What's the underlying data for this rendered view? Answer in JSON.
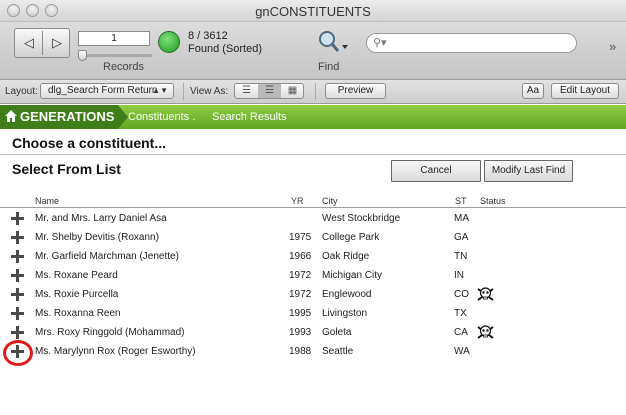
{
  "window": {
    "title": "gnCONSTITUENTS"
  },
  "toolbar": {
    "record_input_value": "1",
    "records_label": "Records",
    "record_count": "8 / 3612",
    "found_status": "Found (Sorted)",
    "find_label": "Find",
    "search_placeholder": "",
    "overflow_glyph": "»"
  },
  "layout_bar": {
    "layout_label": "Layout:",
    "layout_value": "dlg_Search Form Return",
    "view_as_label": "View As:",
    "preview_label": "Preview",
    "text_format_label": "Aa",
    "edit_layout_label": "Edit Layout"
  },
  "banner": {
    "app_name": "GENERATIONS",
    "breadcrumb_1": "Constituents .",
    "breadcrumb_2": "Search Results",
    "color": "#5ea821"
  },
  "dialog": {
    "heading": "Choose a constituent...",
    "subheading": "Select From List",
    "cancel_label": "Cancel",
    "modify_label": "Modify Last Find"
  },
  "table": {
    "columns": {
      "name": "Name",
      "yr": "YR",
      "city": "City",
      "st": "ST",
      "status": "Status"
    },
    "rows": [
      {
        "name": "Mr. and Mrs. Larry Daniel Asa",
        "yr": "",
        "city": "West Stockbridge",
        "st": "MA",
        "status": ""
      },
      {
        "name": "Mr. Shelby Devitis (Roxann)",
        "yr": "1975",
        "city": "College Park",
        "st": "GA",
        "status": ""
      },
      {
        "name": "Mr. Garfield Marchman (Jenette)",
        "yr": "1966",
        "city": "Oak Ridge",
        "st": "TN",
        "status": ""
      },
      {
        "name": "Ms. Roxane Peard",
        "yr": "1972",
        "city": "Michigan City",
        "st": "IN",
        "status": ""
      },
      {
        "name": "Ms. Roxie Purcella",
        "yr": "1972",
        "city": "Englewood",
        "st": "CO",
        "status": "skull-icon"
      },
      {
        "name": "Ms. Roxanna Reen",
        "yr": "1995",
        "city": "Livingston",
        "st": "TX",
        "status": ""
      },
      {
        "name": "Mrs. Roxy Ringgold (Mohammad)",
        "yr": "1993",
        "city": "Goleta",
        "st": "CA",
        "status": "skull-icon"
      },
      {
        "name": "Ms. Marylynn Rox (Roger Esworthy)",
        "yr": "1988",
        "city": "Seattle",
        "st": "WA",
        "status": ""
      }
    ]
  },
  "annotation": {
    "highlight_color": "#e01a1a"
  }
}
